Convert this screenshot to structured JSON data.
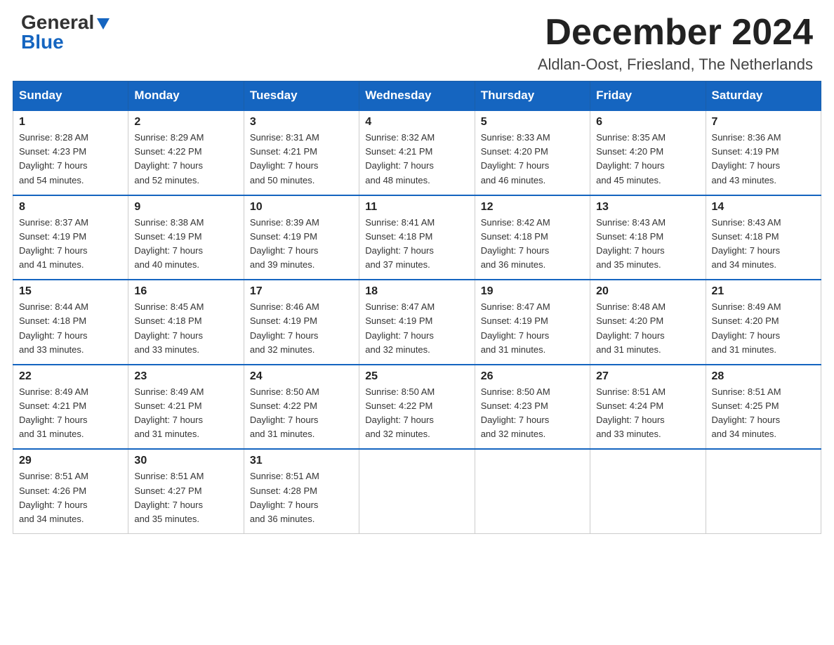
{
  "header": {
    "logo_general": "General",
    "logo_blue": "Blue",
    "title": "December 2024",
    "location": "Aldlan-Oost, Friesland, The Netherlands"
  },
  "calendar": {
    "days_of_week": [
      "Sunday",
      "Monday",
      "Tuesday",
      "Wednesday",
      "Thursday",
      "Friday",
      "Saturday"
    ],
    "weeks": [
      [
        {
          "day": "1",
          "info": "Sunrise: 8:28 AM\nSunset: 4:23 PM\nDaylight: 7 hours\nand 54 minutes."
        },
        {
          "day": "2",
          "info": "Sunrise: 8:29 AM\nSunset: 4:22 PM\nDaylight: 7 hours\nand 52 minutes."
        },
        {
          "day": "3",
          "info": "Sunrise: 8:31 AM\nSunset: 4:21 PM\nDaylight: 7 hours\nand 50 minutes."
        },
        {
          "day": "4",
          "info": "Sunrise: 8:32 AM\nSunset: 4:21 PM\nDaylight: 7 hours\nand 48 minutes."
        },
        {
          "day": "5",
          "info": "Sunrise: 8:33 AM\nSunset: 4:20 PM\nDaylight: 7 hours\nand 46 minutes."
        },
        {
          "day": "6",
          "info": "Sunrise: 8:35 AM\nSunset: 4:20 PM\nDaylight: 7 hours\nand 45 minutes."
        },
        {
          "day": "7",
          "info": "Sunrise: 8:36 AM\nSunset: 4:19 PM\nDaylight: 7 hours\nand 43 minutes."
        }
      ],
      [
        {
          "day": "8",
          "info": "Sunrise: 8:37 AM\nSunset: 4:19 PM\nDaylight: 7 hours\nand 41 minutes."
        },
        {
          "day": "9",
          "info": "Sunrise: 8:38 AM\nSunset: 4:19 PM\nDaylight: 7 hours\nand 40 minutes."
        },
        {
          "day": "10",
          "info": "Sunrise: 8:39 AM\nSunset: 4:19 PM\nDaylight: 7 hours\nand 39 minutes."
        },
        {
          "day": "11",
          "info": "Sunrise: 8:41 AM\nSunset: 4:18 PM\nDaylight: 7 hours\nand 37 minutes."
        },
        {
          "day": "12",
          "info": "Sunrise: 8:42 AM\nSunset: 4:18 PM\nDaylight: 7 hours\nand 36 minutes."
        },
        {
          "day": "13",
          "info": "Sunrise: 8:43 AM\nSunset: 4:18 PM\nDaylight: 7 hours\nand 35 minutes."
        },
        {
          "day": "14",
          "info": "Sunrise: 8:43 AM\nSunset: 4:18 PM\nDaylight: 7 hours\nand 34 minutes."
        }
      ],
      [
        {
          "day": "15",
          "info": "Sunrise: 8:44 AM\nSunset: 4:18 PM\nDaylight: 7 hours\nand 33 minutes."
        },
        {
          "day": "16",
          "info": "Sunrise: 8:45 AM\nSunset: 4:18 PM\nDaylight: 7 hours\nand 33 minutes."
        },
        {
          "day": "17",
          "info": "Sunrise: 8:46 AM\nSunset: 4:19 PM\nDaylight: 7 hours\nand 32 minutes."
        },
        {
          "day": "18",
          "info": "Sunrise: 8:47 AM\nSunset: 4:19 PM\nDaylight: 7 hours\nand 32 minutes."
        },
        {
          "day": "19",
          "info": "Sunrise: 8:47 AM\nSunset: 4:19 PM\nDaylight: 7 hours\nand 31 minutes."
        },
        {
          "day": "20",
          "info": "Sunrise: 8:48 AM\nSunset: 4:20 PM\nDaylight: 7 hours\nand 31 minutes."
        },
        {
          "day": "21",
          "info": "Sunrise: 8:49 AM\nSunset: 4:20 PM\nDaylight: 7 hours\nand 31 minutes."
        }
      ],
      [
        {
          "day": "22",
          "info": "Sunrise: 8:49 AM\nSunset: 4:21 PM\nDaylight: 7 hours\nand 31 minutes."
        },
        {
          "day": "23",
          "info": "Sunrise: 8:49 AM\nSunset: 4:21 PM\nDaylight: 7 hours\nand 31 minutes."
        },
        {
          "day": "24",
          "info": "Sunrise: 8:50 AM\nSunset: 4:22 PM\nDaylight: 7 hours\nand 31 minutes."
        },
        {
          "day": "25",
          "info": "Sunrise: 8:50 AM\nSunset: 4:22 PM\nDaylight: 7 hours\nand 32 minutes."
        },
        {
          "day": "26",
          "info": "Sunrise: 8:50 AM\nSunset: 4:23 PM\nDaylight: 7 hours\nand 32 minutes."
        },
        {
          "day": "27",
          "info": "Sunrise: 8:51 AM\nSunset: 4:24 PM\nDaylight: 7 hours\nand 33 minutes."
        },
        {
          "day": "28",
          "info": "Sunrise: 8:51 AM\nSunset: 4:25 PM\nDaylight: 7 hours\nand 34 minutes."
        }
      ],
      [
        {
          "day": "29",
          "info": "Sunrise: 8:51 AM\nSunset: 4:26 PM\nDaylight: 7 hours\nand 34 minutes."
        },
        {
          "day": "30",
          "info": "Sunrise: 8:51 AM\nSunset: 4:27 PM\nDaylight: 7 hours\nand 35 minutes."
        },
        {
          "day": "31",
          "info": "Sunrise: 8:51 AM\nSunset: 4:28 PM\nDaylight: 7 hours\nand 36 minutes."
        },
        {
          "day": "",
          "info": ""
        },
        {
          "day": "",
          "info": ""
        },
        {
          "day": "",
          "info": ""
        },
        {
          "day": "",
          "info": ""
        }
      ]
    ]
  }
}
